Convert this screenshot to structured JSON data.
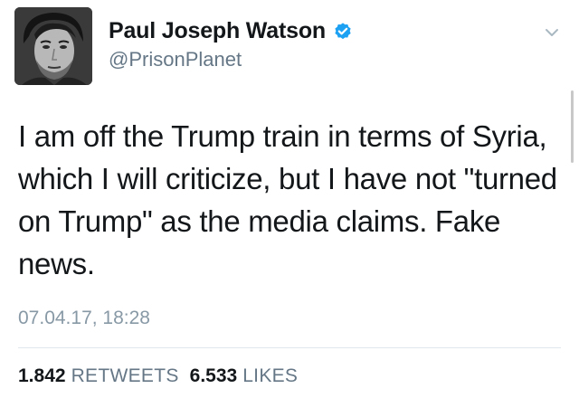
{
  "tweet": {
    "author": {
      "display_name": "Paul Joseph Watson",
      "handle": "@PrisonPlanet",
      "verified": true,
      "avatar_icon": "profile-photo"
    },
    "text": "I am off the Trump train in terms of Syria, which I will criticize, but I have not \"turned on Trump\" as the media claims. Fake news.",
    "timestamp": "07.04.17, 18:28",
    "stats": {
      "retweets_count": "1.842",
      "retweets_label": "RETWEETS",
      "likes_count": "6.533",
      "likes_label": "LIKES"
    },
    "menu_icon": "chevron-down-icon"
  },
  "colors": {
    "verified_blue": "#1da1f2",
    "secondary_text": "#657786",
    "timestamp_text": "#8899a6",
    "divider": "#e1e8ed"
  }
}
